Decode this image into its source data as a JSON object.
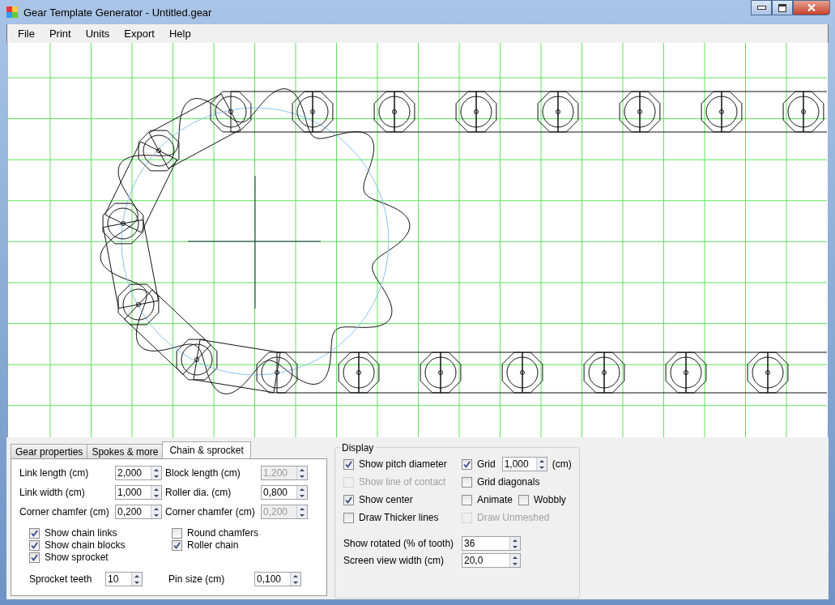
{
  "window": {
    "title": "Gear Template Generator - Untitled.gear"
  },
  "menu": [
    "File",
    "Print",
    "Units",
    "Export",
    "Help"
  ],
  "tabs": [
    {
      "label": "Gear properties",
      "selected": false
    },
    {
      "label": "Spokes & more",
      "selected": false
    },
    {
      "label": "Chain & sprocket",
      "selected": true
    }
  ],
  "chain_fields": [
    {
      "label": "Link length (cm)",
      "value": "2,000",
      "disabled": false
    },
    {
      "label": "Block length (cm)",
      "value": "1,200",
      "disabled": true
    },
    {
      "label": "Link width (cm)",
      "value": "1,000",
      "disabled": false
    },
    {
      "label": "Roller dia. (cm)",
      "value": "0,800",
      "disabled": false
    },
    {
      "label": "Corner chamfer (cm)",
      "value": "0,200",
      "disabled": false
    },
    {
      "label": "Corner chamfer (cm)",
      "value": "0,200",
      "disabled": true
    }
  ],
  "chain_checkboxes": [
    {
      "label": "Show chain links",
      "checked": true
    },
    {
      "label": "Round chamfers",
      "checked": false
    },
    {
      "label": "Show chain blocks",
      "checked": true
    },
    {
      "label": "Roller chain",
      "checked": true
    },
    {
      "label": "Show sprocket",
      "checked": true
    }
  ],
  "sprocket_teeth": {
    "label": "Sprocket teeth",
    "value": "10"
  },
  "pin_size": {
    "label": "Pin size (cm)",
    "value": "0,100"
  },
  "display": {
    "title": "Display",
    "checkboxes": [
      {
        "label": "Show pitch diameter",
        "checked": true,
        "disabled": false
      },
      {
        "label": "Grid",
        "checked": true,
        "disabled": false
      },
      {
        "label": "Show line of contact",
        "checked": false,
        "disabled": true
      },
      {
        "label": "Grid diagonals",
        "checked": false,
        "disabled": false
      },
      {
        "label": "Show center",
        "checked": true,
        "disabled": false
      },
      {
        "label": "Animate",
        "checked": false,
        "disabled": false
      },
      {
        "label": "Wobbly",
        "checked": false,
        "disabled": false
      },
      {
        "label": "Draw Thicker lines",
        "checked": false,
        "disabled": false
      },
      {
        "label": "Draw Unmeshed",
        "checked": false,
        "disabled": true
      }
    ],
    "grid_size": {
      "value": "1,000",
      "unit": "(cm)"
    },
    "rotated": {
      "label": "Show rotated (% of tooth)",
      "value": "36"
    },
    "view_width": {
      "label": "Screen view width (cm)",
      "value": "20,0"
    }
  }
}
